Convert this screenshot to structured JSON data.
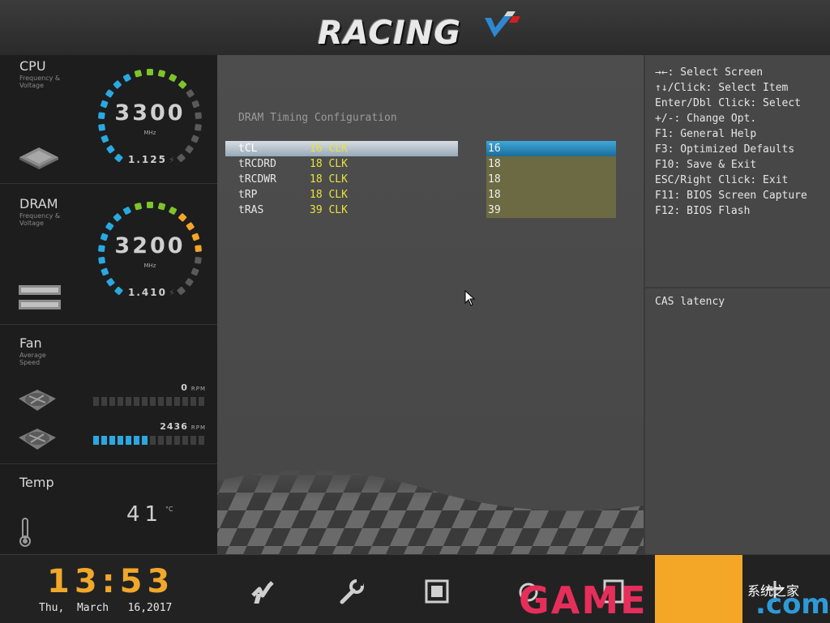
{
  "header": {
    "logo_text": "RACING"
  },
  "sidebar": {
    "cpu": {
      "title": "CPU",
      "subtitle": "Frequency &\nVoltage",
      "freq": "3300",
      "unit": "MHz",
      "voltage": "1.125"
    },
    "dram": {
      "title": "DRAM",
      "subtitle": "Frequency &\nVoltage",
      "freq": "3200",
      "unit": "MHz",
      "voltage": "1.410"
    },
    "fan": {
      "title": "Fan",
      "subtitle": "Average\nSpeed",
      "fans": [
        {
          "rpm": "0",
          "unit": "RPM",
          "level": 0
        },
        {
          "rpm": "2436",
          "unit": "RPM",
          "level": 0.5
        }
      ]
    },
    "temp": {
      "title": "Temp",
      "value": "41",
      "unit": "°C"
    }
  },
  "main": {
    "section_title": "DRAM Timing Configuration",
    "rows": [
      {
        "name": "tCL",
        "current": "16 CLK",
        "value": "16",
        "selected": true
      },
      {
        "name": "tRCDRD",
        "current": "18 CLK",
        "value": "18",
        "selected": false
      },
      {
        "name": "tRCDWR",
        "current": "18 CLK",
        "value": "18",
        "selected": false
      },
      {
        "name": "tRP",
        "current": "18 CLK",
        "value": "18",
        "selected": false
      },
      {
        "name": "tRAS",
        "current": "39 CLK",
        "value": "39",
        "selected": false
      }
    ]
  },
  "help": {
    "items": [
      "→←: Select Screen",
      "↑↓/Click: Select Item",
      "Enter/Dbl Click: Select",
      "+/-: Change Opt.",
      "F1: General Help",
      "F3: Optimized Defaults",
      "F10: Save & Exit",
      "ESC/Right Click: Exit",
      "F11: BIOS Screen Capture",
      "F12: BIOS Flash"
    ],
    "description": "CAS latency"
  },
  "footer": {
    "time": "13:53",
    "date": "Thu,  March   16,2017"
  },
  "watermark": {
    "text": "GAME",
    "suffix": ".com",
    "cn": "系统之家"
  },
  "colors": {
    "accent": "#f4a627",
    "selected_blue": "#2aa8e0",
    "value_yellow": "#e8e23c"
  }
}
